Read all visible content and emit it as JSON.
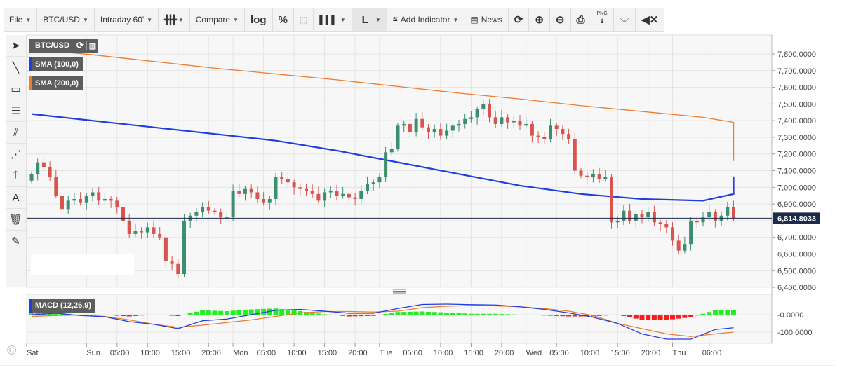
{
  "toolbar": {
    "file": "File",
    "symbol": "BTC/USD",
    "interval": "Intraday 60'",
    "compare": "Compare",
    "log": "log",
    "percent": "%",
    "line_type": "L",
    "add_indicator": "Add Indicator",
    "news": "News",
    "png": "PNG"
  },
  "icons": [
    "candlestick-icon",
    "crosshair-icon",
    "histogram-icon",
    "indicator-icon",
    "news-icon",
    "refresh-icon",
    "zoom-in-icon",
    "zoom-out-icon",
    "print-icon",
    "png-download-icon",
    "fullscreen-icon",
    "mute-icon"
  ],
  "left_tools": [
    "cursor",
    "line",
    "rectangle",
    "fibonacci",
    "parallel-channel",
    "pitchfork",
    "arrow",
    "text",
    "trash",
    "pencil"
  ],
  "legend": {
    "symbol": "BTC/USD",
    "sma100": "SMA (100,0)",
    "sma200": "SMA (200,0)",
    "macd": "MACD (12,26,9)"
  },
  "colors": {
    "up": "#3a8f6f",
    "down": "#d9534f",
    "sma100": "#1f3ee0",
    "sma200": "#f07b2a",
    "macd": "#1f3ee0",
    "signal": "#f07b2a",
    "hist_up": "#22ee22",
    "hist_down": "#ff1a1a",
    "price_line": "#1c2b4a"
  },
  "copyright": "©",
  "chart_data": [
    {
      "type": "candlestick",
      "interval_minutes": 60,
      "start": "Sat 15:00",
      "ylim": [
        6400,
        7850
      ],
      "y_ticks": [
        "7,800.0000",
        "7,700.0000",
        "7,600.0000",
        "7,500.0000",
        "7,400.0000",
        "7,300.0000",
        "7,200.0000",
        "7,100.0000",
        "7,000.0000",
        "6,900.0000",
        "6,800.0000",
        "6,700.0000",
        "6,600.0000",
        "6,500.0000",
        "6,400.0000"
      ],
      "x_ticks": [
        [
          "Sat",
          -0.8
        ],
        [
          "Sun",
          9
        ],
        [
          "05:00",
          14
        ],
        [
          "10:00",
          19
        ],
        [
          "15:00",
          24
        ],
        [
          "20:00",
          29
        ],
        [
          "Mon",
          33
        ],
        [
          "05:00",
          38
        ],
        [
          "10:00",
          43
        ],
        [
          "15:00",
          48
        ],
        [
          "20:00",
          53
        ],
        [
          "Tue",
          57
        ],
        [
          "05:00",
          62
        ],
        [
          "10:00",
          67
        ],
        [
          "15:00",
          72
        ],
        [
          "20:00",
          77
        ],
        [
          "Wed",
          81
        ],
        [
          "05:00",
          86
        ],
        [
          "10:00",
          91
        ],
        [
          "15:00",
          96
        ],
        [
          "20:00",
          101
        ],
        [
          "Thu",
          105
        ],
        [
          "06:00",
          111
        ]
      ],
      "first_open": 7040,
      "close": [
        7080,
        7150,
        7120,
        7060,
        6950,
        6870,
        6920,
        6930,
        6910,
        6950,
        6970,
        6920,
        6930,
        6920,
        6880,
        6800,
        6720,
        6740,
        6730,
        6760,
        6720,
        6700,
        6560,
        6540,
        6480,
        6800,
        6830,
        6850,
        6880,
        6860,
        6850,
        6820,
        6820,
        6980,
        6960,
        6990,
        6970,
        6930,
        6910,
        6930,
        7060,
        7050,
        7030,
        7000,
        6990,
        6980,
        6960,
        6920,
        6970,
        6980,
        6950,
        6960,
        6940,
        6930,
        6980,
        7020,
        7030,
        7060,
        7210,
        7230,
        7370,
        7380,
        7330,
        7410,
        7360,
        7330,
        7350,
        7310,
        7340,
        7370,
        7380,
        7410,
        7420,
        7470,
        7500,
        7420,
        7380,
        7420,
        7390,
        7400,
        7370,
        7380,
        7310,
        7300,
        7290,
        7370,
        7350,
        7320,
        7290,
        7100,
        7070,
        7060,
        7080,
        7050,
        7060,
        6790,
        6800,
        6860,
        6800,
        6840,
        6820,
        6850,
        6790,
        6780,
        6760,
        6680,
        6620,
        6660,
        6800,
        6790,
        6820,
        6850,
        6800,
        6830,
        6880,
        6814.8
      ],
      "last_price": "6,814.8033",
      "sma100_every10h": [
        7440,
        7400,
        7360,
        7320,
        7280,
        7220,
        7150,
        7080,
        7010,
        6960,
        6930,
        6920,
        6960,
        6980,
        7010,
        7040,
        7060,
        7065,
        7060,
        7040,
        7030,
        7022
      ],
      "sma200_every10h": [
        7830,
        7795,
        7755,
        7715,
        7680,
        7645,
        7605,
        7565,
        7530,
        7490,
        7455,
        7420,
        7390,
        7365,
        7345,
        7320,
        7295,
        7265,
        7230,
        7200,
        7175,
        7158
      ]
    },
    {
      "type": "line",
      "title": "MACD (12,26,9)",
      "ylim": [
        -130,
        50
      ],
      "y_ticks": [
        "-0.0000",
        "-100.0000"
      ],
      "every4h_macd": [
        0,
        8,
        -5,
        -12,
        -40,
        -55,
        -80,
        -35,
        -25,
        0,
        25,
        30,
        20,
        8,
        8,
        35,
        58,
        60,
        57,
        55,
        45,
        30,
        10,
        -15,
        -50,
        -110,
        -140,
        -140,
        -85,
        -75
      ],
      "every4h_signal": [
        -10,
        -5,
        -2,
        -10,
        -30,
        -55,
        -72,
        -60,
        -45,
        -30,
        -10,
        10,
        18,
        18,
        15,
        20,
        40,
        48,
        52,
        50,
        45,
        35,
        20,
        -5,
        -50,
        -80,
        -110,
        -125,
        -110,
        -100
      ]
    }
  ]
}
